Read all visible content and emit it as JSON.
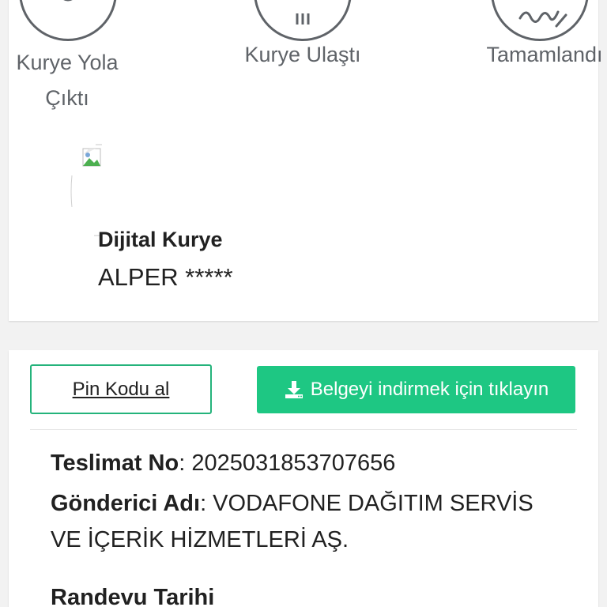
{
  "steps": [
    {
      "label": "Kurye Yola Çıktı",
      "icon": "scooter-icon"
    },
    {
      "label": "Kurye Ulaştı",
      "icon": "building-icon"
    },
    {
      "label": "Tamamlandı",
      "icon": "signature-icon"
    }
  ],
  "courier": {
    "role": "Dijital Kurye",
    "name": "ALPER *****",
    "avatar_icon": "broken-image-icon"
  },
  "actions": {
    "pin_label": "Pin Kodu al",
    "download_label": "Belgeyi indirmek için tıklayın",
    "download_icon": "download-icon"
  },
  "details": {
    "delivery_no_key": "Teslimat No",
    "delivery_no_value": ": 2025031853707656",
    "sender_key": "Gönderici Adı",
    "sender_value": ": VODAFONE DAĞITIM SERVİS VE İÇERİK HİZMETLERİ AŞ.",
    "appointment_key": "Randevu Tarihi"
  },
  "colors": {
    "accent_green": "#1ec783",
    "outline_green": "#24b37b",
    "icon_gray": "#5f6368"
  }
}
